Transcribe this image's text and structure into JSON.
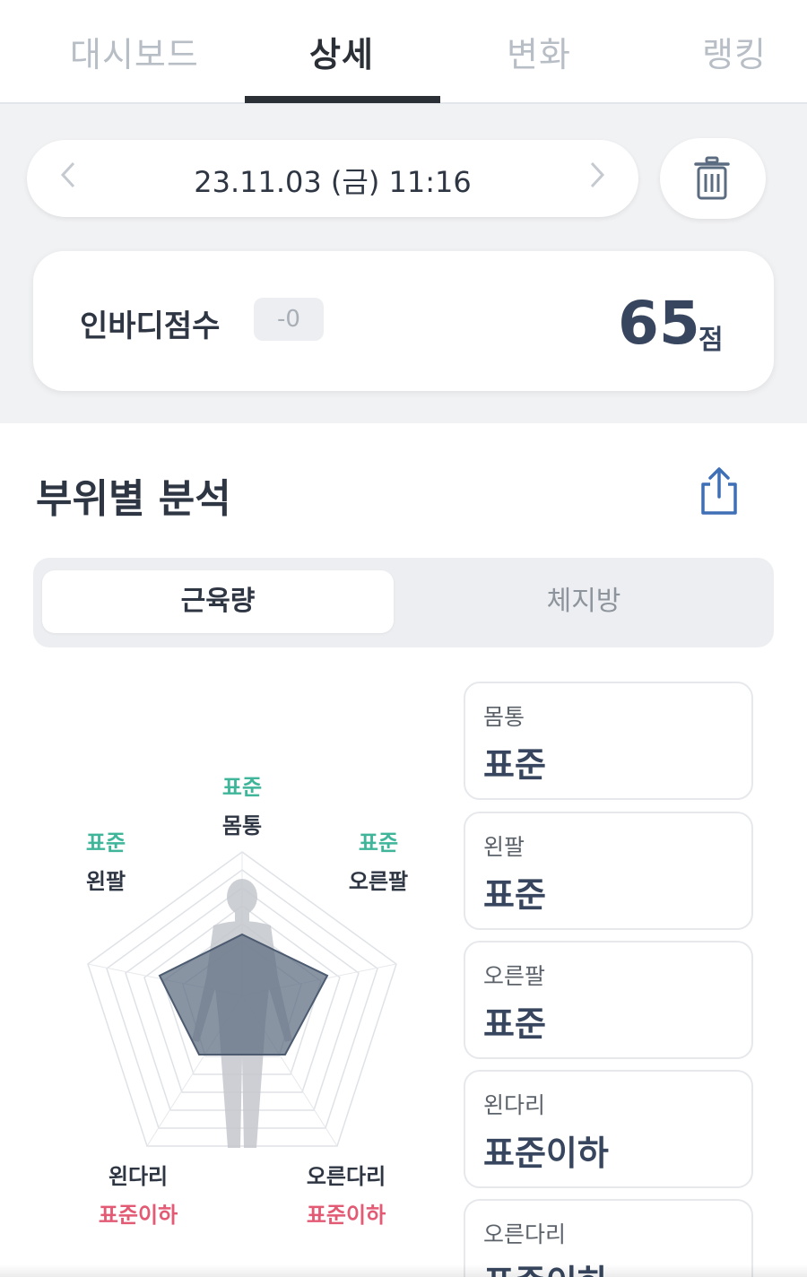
{
  "tabs": [
    {
      "label": "대시보드",
      "active": false
    },
    {
      "label": "상세",
      "active": true
    },
    {
      "label": "변화",
      "active": false
    },
    {
      "label": "랭킹",
      "active": false
    }
  ],
  "date_nav": {
    "date": "23.11.03 (금) 11:16",
    "prev_icon": "chevron-left-icon",
    "next_icon": "chevron-right-icon",
    "delete_icon": "trash-icon"
  },
  "score": {
    "label": "인바디점수",
    "diff": "-0",
    "value": "65",
    "unit": "점"
  },
  "section": {
    "title": "부위별 분석",
    "share_icon": "share-icon"
  },
  "segment": {
    "options": [
      "근육량",
      "체지방"
    ],
    "selected": "근육량"
  },
  "radar": {
    "points": [
      {
        "part": "몸통",
        "status": "표준"
      },
      {
        "part": "왼팔",
        "status": "표준"
      },
      {
        "part": "오른팔",
        "status": "표준"
      },
      {
        "part": "왼다리",
        "status": "표준이하"
      },
      {
        "part": "오른다리",
        "status": "표준이하"
      }
    ],
    "colors": {
      "standard": "#3fb59a",
      "below": "#e35a74",
      "fill": "#5b6b80"
    }
  },
  "cards": [
    {
      "part": "몸통",
      "status": "표준"
    },
    {
      "part": "왼팔",
      "status": "표준"
    },
    {
      "part": "오른팔",
      "status": "표준"
    },
    {
      "part": "왼다리",
      "status": "표준이하"
    },
    {
      "part": "오른다리",
      "status": "표준이하"
    }
  ]
}
